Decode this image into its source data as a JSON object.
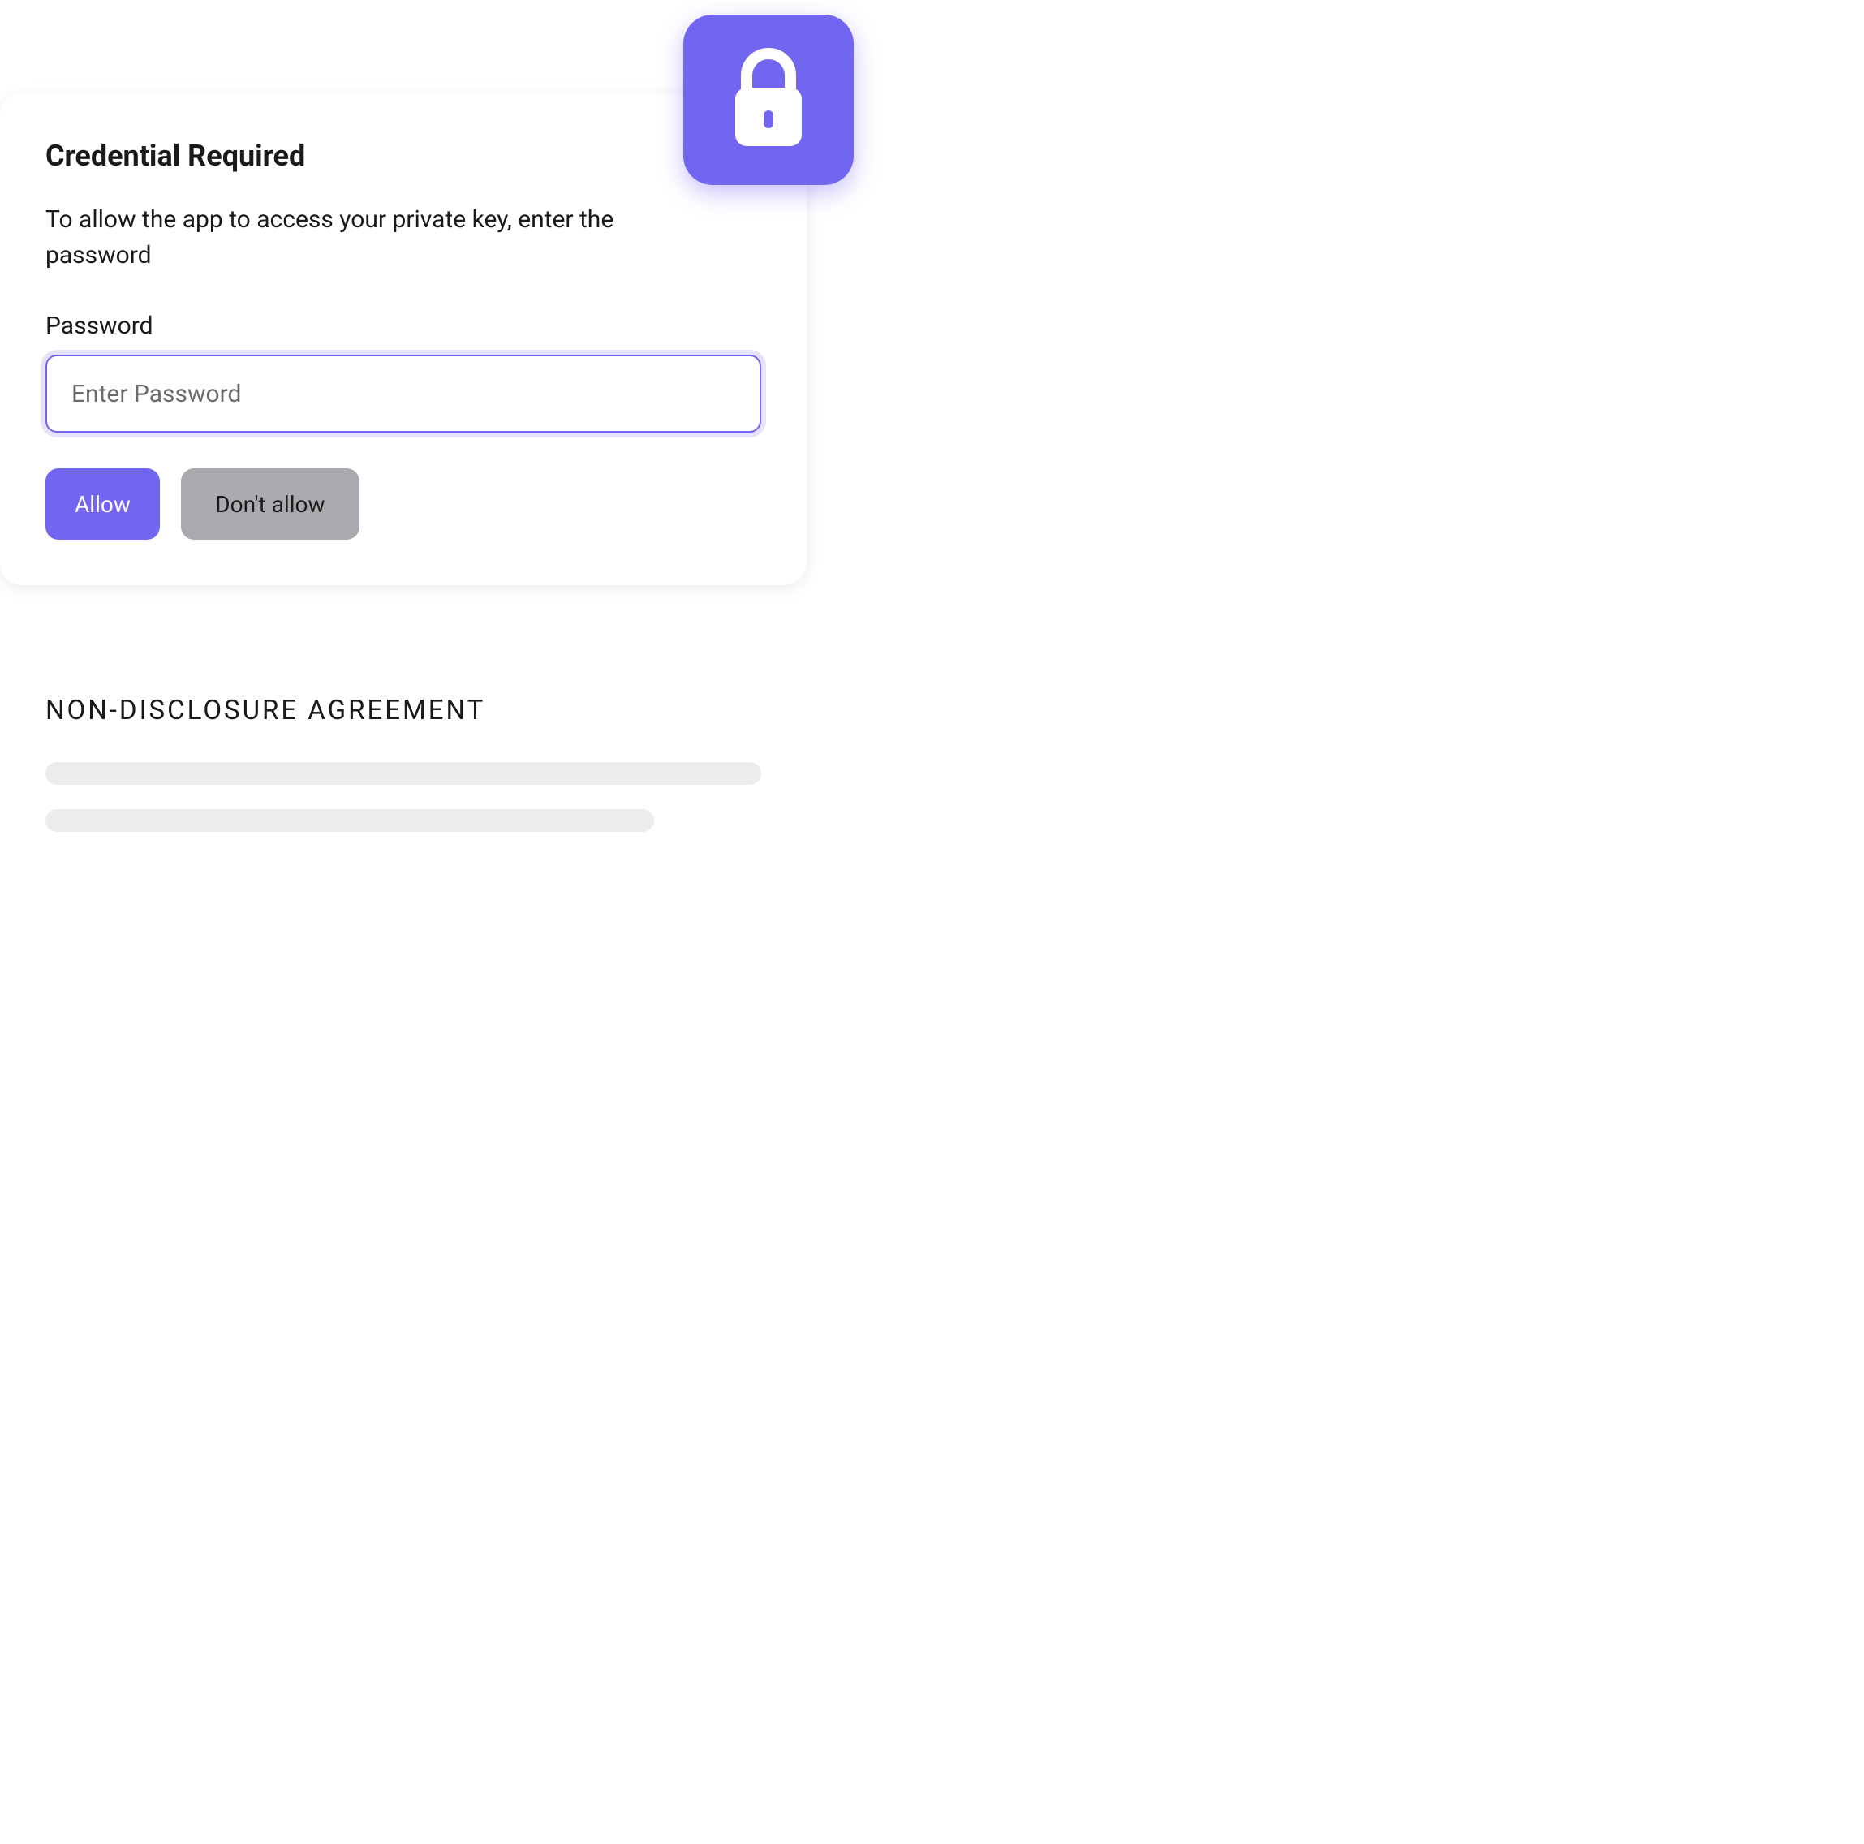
{
  "dialog": {
    "title": "Credential Required",
    "description": "To allow the app to access your private key, enter the password",
    "password_label": "Password",
    "password_placeholder": "Enter Password",
    "password_value": "",
    "allow_label": "Allow",
    "dont_allow_label": "Don't allow",
    "icon": "lock-icon"
  },
  "document": {
    "title": "NON-DISCLOSURE AGREEMENT"
  },
  "colors": {
    "accent": "#7266F0",
    "secondary": "#a9a9ae"
  }
}
